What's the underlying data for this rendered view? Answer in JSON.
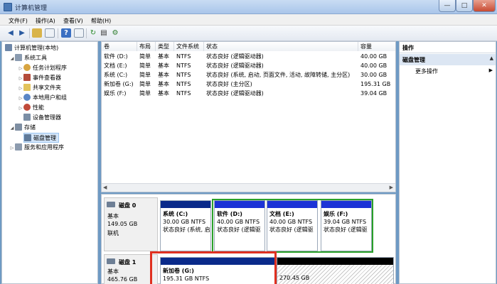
{
  "window": {
    "title": "计算机管理",
    "min": "—",
    "max": "□",
    "close": "✕"
  },
  "menu": [
    "文件(F)",
    "操作(A)",
    "查看(V)",
    "帮助(H)"
  ],
  "tree": {
    "root": "计算机管理(本地)",
    "system_tools": "系统工具",
    "task_scheduler": "任务计划程序",
    "event_viewer": "事件查看器",
    "shared_folders": "共享文件夹",
    "local_users": "本地用户和组",
    "performance": "性能",
    "device_manager": "设备管理器",
    "storage": "存储",
    "disk_management": "磁盘管理",
    "services_apps": "服务和应用程序"
  },
  "volume_table": {
    "headers": [
      "卷",
      "布局",
      "类型",
      "文件系统",
      "状态",
      "容量"
    ],
    "rows": [
      [
        "软件 (D:)",
        "简单",
        "基本",
        "NTFS",
        "状态良好 (逻辑驱动器)",
        "40.00 GB"
      ],
      [
        "文档 (E:)",
        "简单",
        "基本",
        "NTFS",
        "状态良好 (逻辑驱动器)",
        "40.00 GB"
      ],
      [
        "系统 (C:)",
        "简单",
        "基本",
        "NTFS",
        "状态良好 (系统, 启动, 页面文件, 活动, 故障转储, 主分区)",
        "30.00 GB"
      ],
      [
        "新加卷 (G:)",
        "简单",
        "基本",
        "NTFS",
        "状态良好 (主分区)",
        "195.31 GB"
      ],
      [
        "娱乐 (F:)",
        "简单",
        "基本",
        "NTFS",
        "状态良好 (逻辑驱动器)",
        "39.04 GB"
      ]
    ]
  },
  "disks": [
    {
      "name": "磁盘 0",
      "type": "基本",
      "size": "149.05 GB",
      "status": "联机",
      "partitions": [
        {
          "name": "系统 (C:)",
          "size": "30.00 GB NTFS",
          "status": "状态良好 (系统, 启",
          "bar": "#0a2a8a"
        },
        {
          "name": "软件 (D:)",
          "size": "40.00 GB NTFS",
          "status": "状态良好 (逻辑驱",
          "bar": "#1c33d6"
        },
        {
          "name": "文档 (E:)",
          "size": "40.00 GB NTFS",
          "status": "状态良好 (逻辑驱",
          "bar": "#1c33d6"
        },
        {
          "name": "娱乐 (F:)",
          "size": "39.04 GB NTFS",
          "status": "状态良好 (逻辑驱",
          "bar": "#1c33d6"
        }
      ]
    },
    {
      "name": "磁盘 1",
      "type": "基本",
      "size": "465.76 GB",
      "partitions": [
        {
          "name": "新加卷 (G:)",
          "size": "195.31 GB NTFS",
          "bar": "#0a2a8a"
        },
        {
          "size": "270.45 GB",
          "bar": "#000000"
        }
      ]
    }
  ],
  "actions": {
    "header": "操作",
    "section": "磁盘管理",
    "more": "更多操作",
    "more_arrow": "▶"
  },
  "colors": {
    "extended_border": "#2aa02a",
    "highlight": "#e03020",
    "primary_bar": "#0a2a8a",
    "logical_bar": "#1c33d6"
  }
}
